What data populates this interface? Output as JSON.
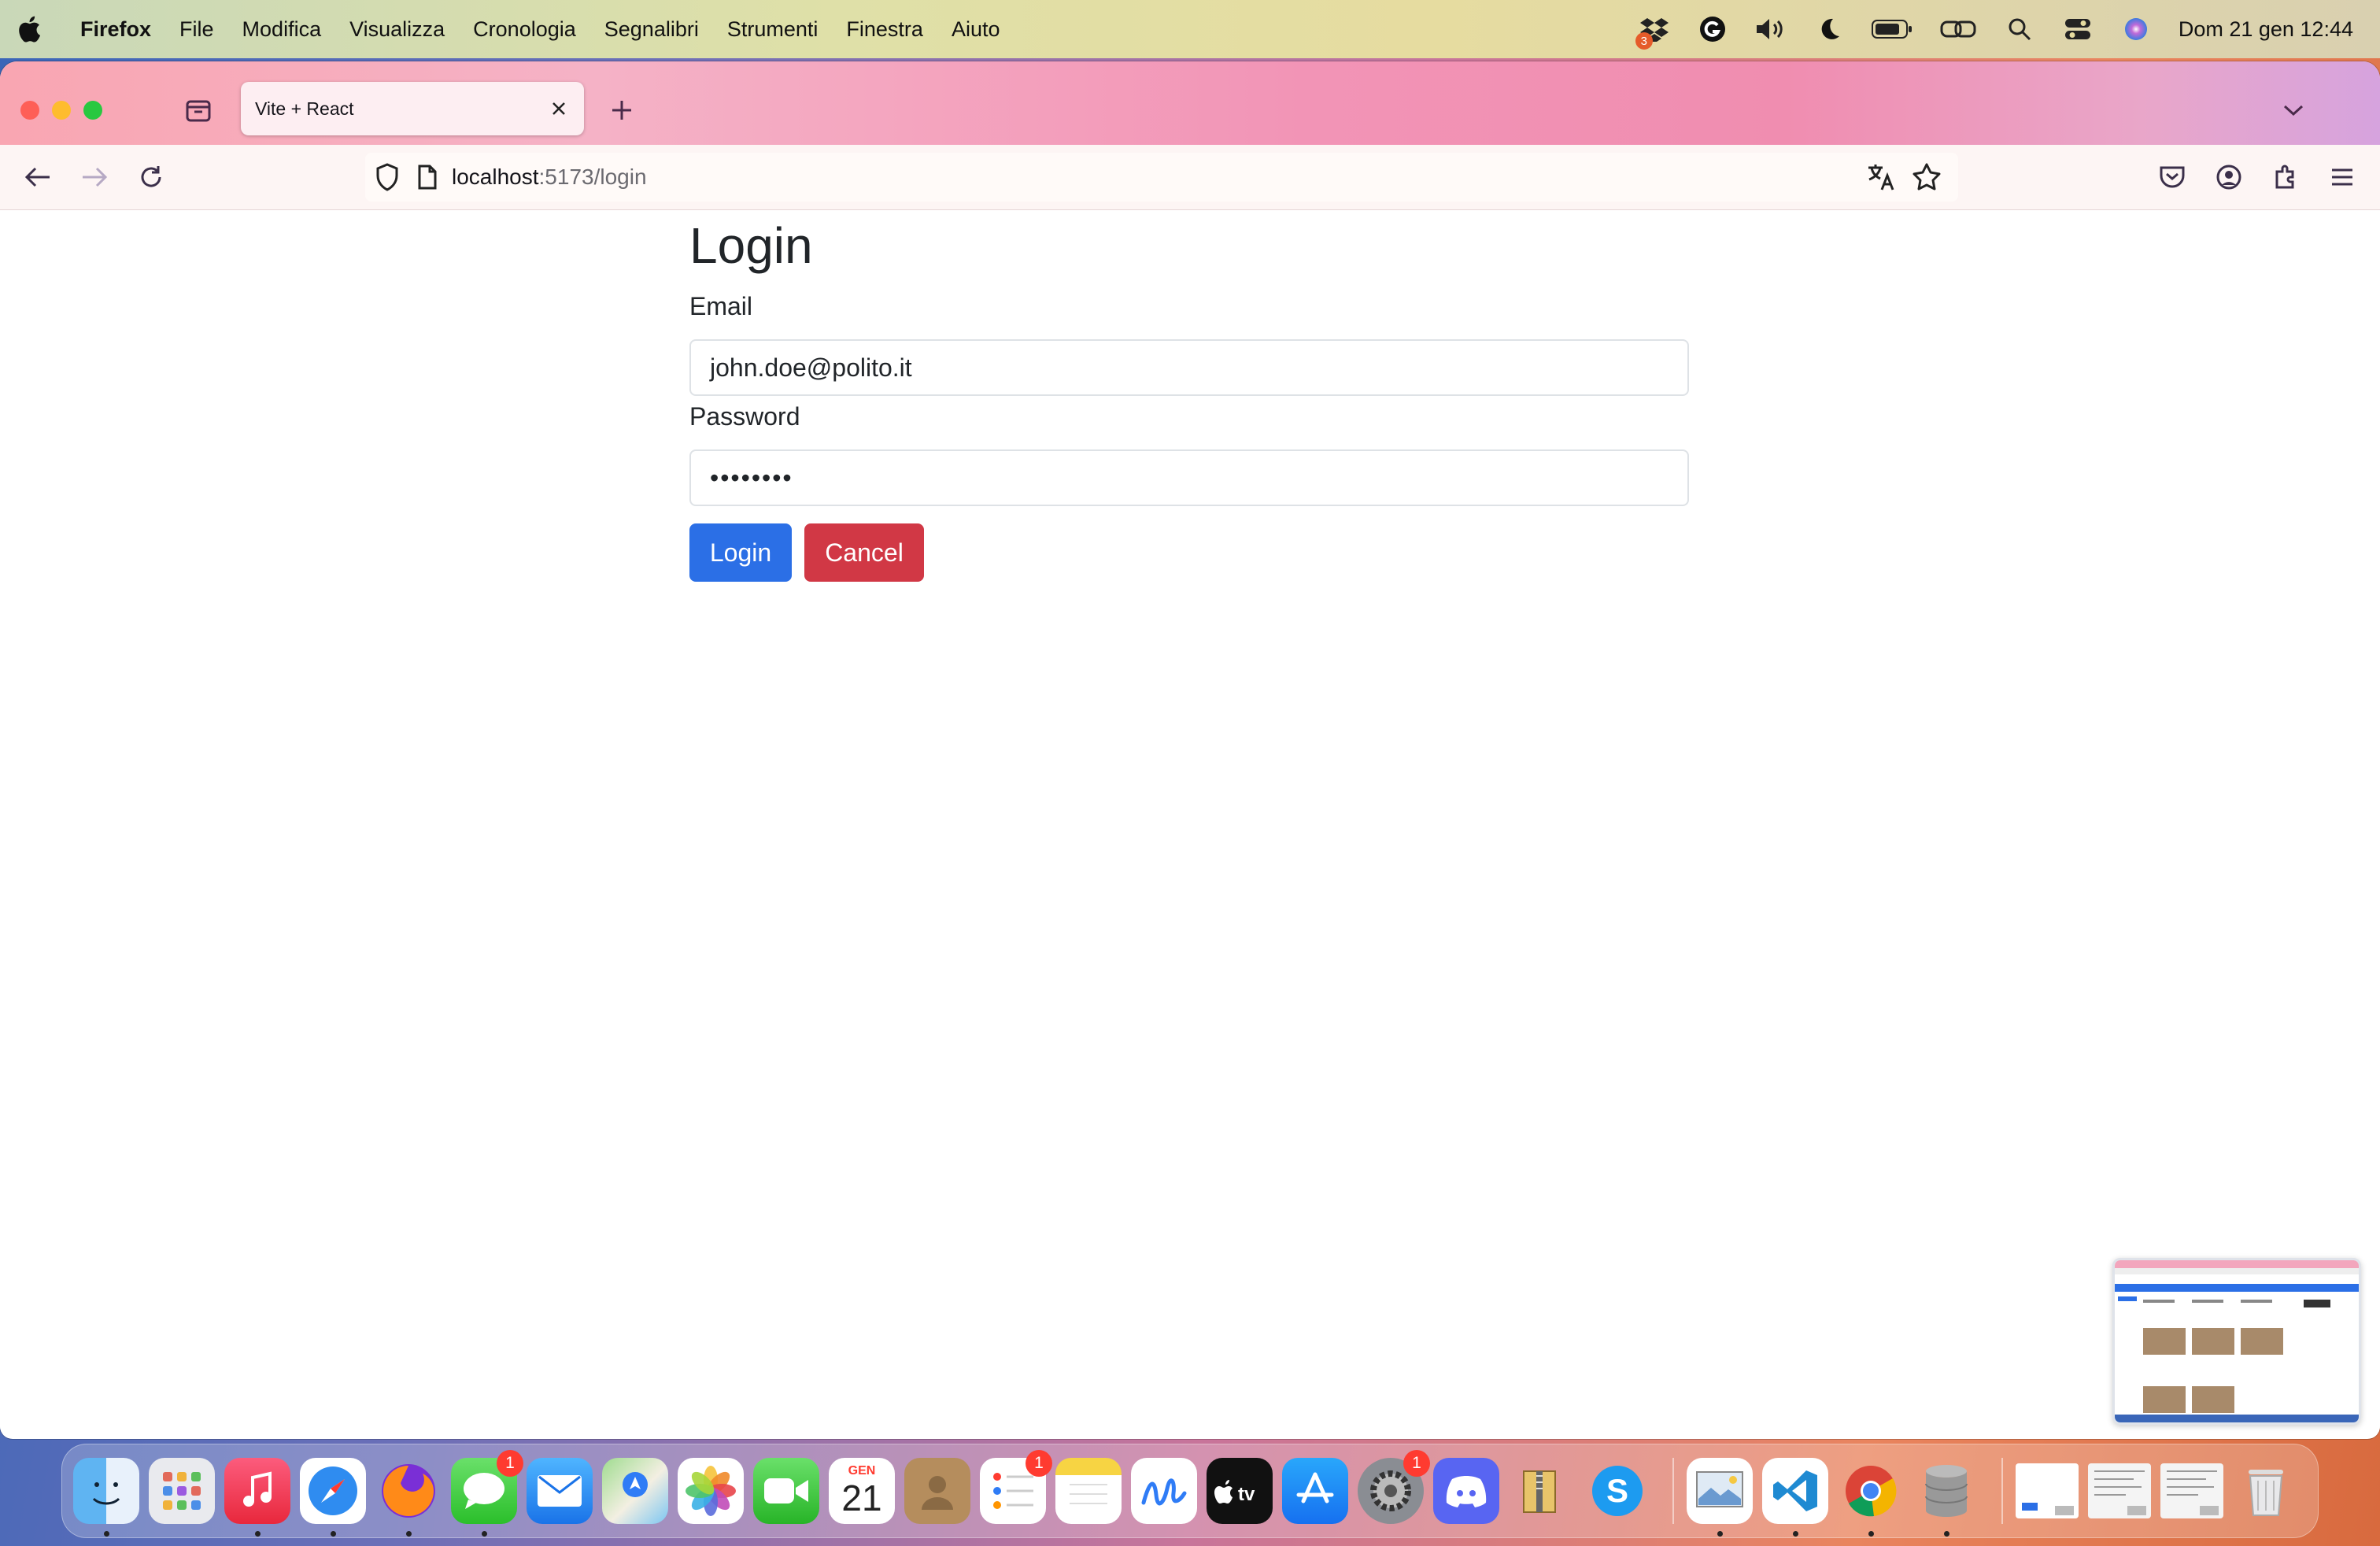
{
  "menubar": {
    "app_name": "Firefox",
    "items": [
      "File",
      "Modifica",
      "Visualizza",
      "Cronologia",
      "Segnalibri",
      "Strumenti",
      "Finestra",
      "Aiuto"
    ],
    "dropbox_badge": "3",
    "clock": "Dom 21 gen  12:44"
  },
  "browser": {
    "tab_title": "Vite + React",
    "url_host": "localhost",
    "url_path": ":5173/login"
  },
  "login": {
    "title": "Login",
    "email_label": "Email",
    "email_value": "john.doe@polito.it",
    "password_label": "Password",
    "password_value": "••••••••",
    "login_button": "Login",
    "cancel_button": "Cancel"
  },
  "dock": {
    "calendar_month": "GEN",
    "calendar_day": "21",
    "messages_badge": "1",
    "reminders_badge": "1",
    "settings_badge": "1"
  },
  "colors": {
    "primary": "#2b6fe6",
    "danger": "#d13845"
  }
}
